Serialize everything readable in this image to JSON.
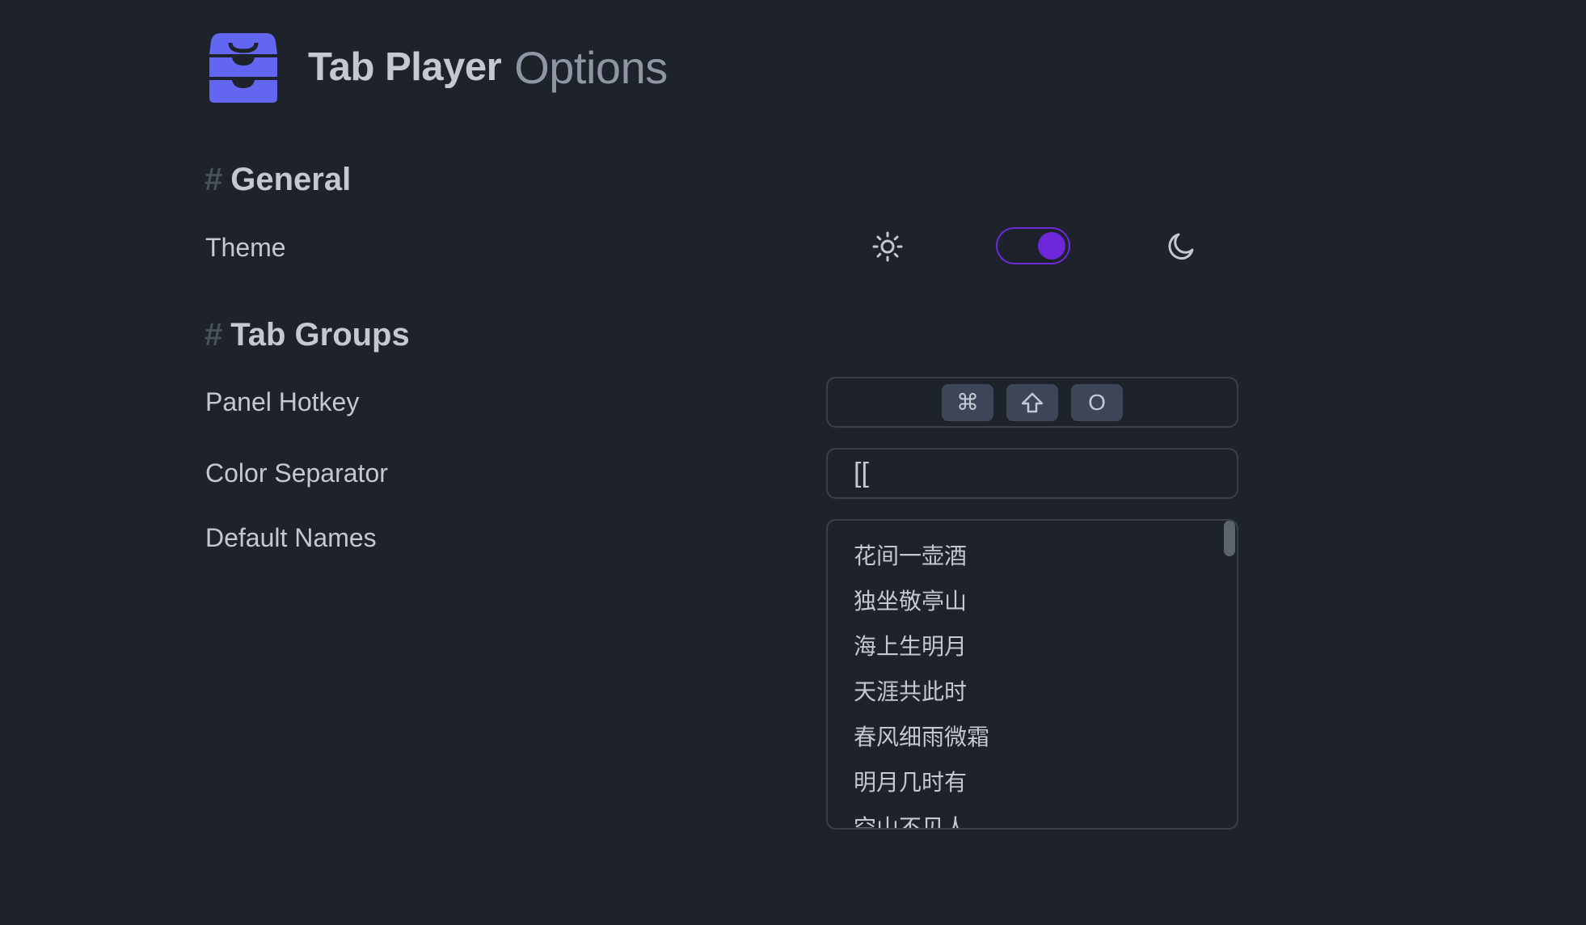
{
  "app": {
    "title_main": "Tab Player",
    "title_sub": "Options",
    "logo_icon": "inbox-tray-icon",
    "accent_color": "#6d28d9",
    "logo_color": "#6366f1"
  },
  "general": {
    "heading_hash": "#",
    "heading": "General",
    "theme": {
      "label": "Theme",
      "light_icon": "sun-icon",
      "dark_icon": "moon-icon",
      "toggle_state": "dark"
    }
  },
  "tab_groups": {
    "heading_hash": "#",
    "heading": "Tab Groups",
    "panel_hotkey": {
      "label": "Panel Hotkey",
      "keys": [
        "⌘",
        "shift-icon",
        "O"
      ],
      "key_o": "O"
    },
    "color_separator": {
      "label": "Color Separator",
      "value": "[["
    },
    "default_names": {
      "label": "Default Names",
      "items": [
        "花间一壶酒",
        "独坐敬亭山",
        "海上生明月",
        "天涯共此时",
        "春风细雨微霜",
        "明月几时有",
        "空山不见人"
      ]
    }
  }
}
